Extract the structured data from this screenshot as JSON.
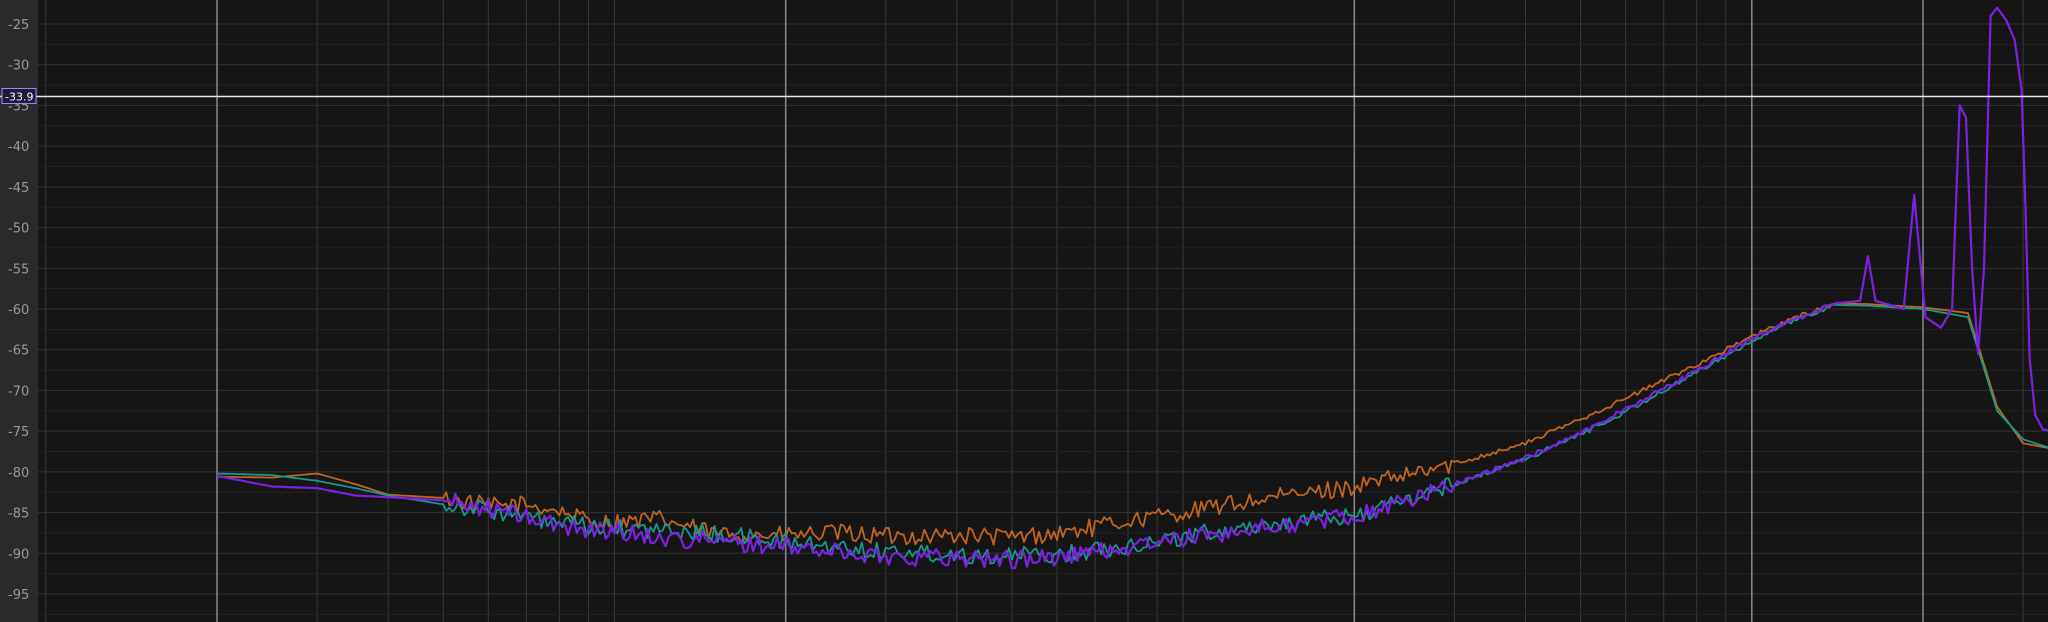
{
  "chart_data": {
    "type": "line",
    "title": "",
    "xlabel": "",
    "ylabel": "",
    "x_scale": "log",
    "xlim": [
      10,
      30000
    ],
    "ylim": [
      -97.5,
      -21.5
    ],
    "grid": true,
    "legend": "none",
    "y_ticks": [
      -25,
      -30,
      -35,
      -40,
      -45,
      -50,
      -55,
      -60,
      -65,
      -70,
      -75,
      -80,
      -85,
      -90,
      -95
    ],
    "y_tick_labels": [
      "-25",
      "-30",
      "-35",
      "-40",
      "-45",
      "-50",
      "-55",
      "-60",
      "-65",
      "-70",
      "-75",
      "-80",
      "-85",
      "-90",
      "-95"
    ],
    "major_x_lines": [
      20,
      200,
      2000,
      10000,
      20000
    ],
    "cursor": {
      "level": -33.9,
      "label": "-33.9"
    },
    "series": [
      {
        "color": "#c0651e",
        "points": [
          [
            20,
            -80.6
          ],
          [
            25,
            -80.7
          ],
          [
            30,
            -80.2
          ],
          [
            35,
            -81.5
          ],
          [
            40,
            -82.8
          ],
          [
            50,
            -83.2
          ],
          [
            60,
            -84.2
          ],
          [
            70,
            -84.0
          ],
          [
            80,
            -84.8
          ],
          [
            90,
            -86.0
          ],
          [
            100,
            -86.2
          ],
          [
            120,
            -85.8
          ],
          [
            150,
            -87.6
          ],
          [
            200,
            -87.8
          ],
          [
            250,
            -87.5
          ],
          [
            300,
            -87.9
          ],
          [
            400,
            -87.8
          ],
          [
            500,
            -88.0
          ],
          [
            600,
            -87.6
          ],
          [
            700,
            -86.8
          ],
          [
            800,
            -86.0
          ],
          [
            1000,
            -85.0
          ],
          [
            1200,
            -84.0
          ],
          [
            1500,
            -83.0
          ],
          [
            2000,
            -81.8
          ],
          [
            2500,
            -80.4
          ],
          [
            3000,
            -79.0
          ],
          [
            4000,
            -76.5
          ],
          [
            5000,
            -73.5
          ],
          [
            6000,
            -71.0
          ],
          [
            8000,
            -66.8
          ],
          [
            10000,
            -63.4
          ],
          [
            12000,
            -61.0
          ],
          [
            14000,
            -59.3
          ],
          [
            16000,
            -59.4
          ],
          [
            20000,
            -59.8
          ],
          [
            24000,
            -60.5
          ],
          [
            27000,
            -72.0
          ],
          [
            30000,
            -76.5
          ],
          [
            36000,
            -77.5
          ]
        ]
      },
      {
        "color": "#17988a",
        "points": [
          [
            20,
            -80.2
          ],
          [
            25,
            -80.4
          ],
          [
            30,
            -81.1
          ],
          [
            35,
            -82.0
          ],
          [
            40,
            -82.9
          ],
          [
            50,
            -84.0
          ],
          [
            60,
            -84.6
          ],
          [
            70,
            -85.6
          ],
          [
            80,
            -86.4
          ],
          [
            90,
            -86.7
          ],
          [
            100,
            -87.0
          ],
          [
            120,
            -87.2
          ],
          [
            150,
            -87.6
          ],
          [
            200,
            -88.6
          ],
          [
            250,
            -89.3
          ],
          [
            300,
            -89.7
          ],
          [
            400,
            -90.1
          ],
          [
            500,
            -90.3
          ],
          [
            600,
            -90.2
          ],
          [
            700,
            -89.6
          ],
          [
            800,
            -89.0
          ],
          [
            1000,
            -88.0
          ],
          [
            1200,
            -87.0
          ],
          [
            1500,
            -86.3
          ],
          [
            2000,
            -85.4
          ],
          [
            2500,
            -83.4
          ],
          [
            3000,
            -81.5
          ],
          [
            4000,
            -78.4
          ],
          [
            5000,
            -75.4
          ],
          [
            6000,
            -72.6
          ],
          [
            8000,
            -67.8
          ],
          [
            10000,
            -63.9
          ],
          [
            12000,
            -61.3
          ],
          [
            14000,
            -59.5
          ],
          [
            16000,
            -59.6
          ],
          [
            20000,
            -60.0
          ],
          [
            24000,
            -61.0
          ],
          [
            27000,
            -72.5
          ],
          [
            30000,
            -76.0
          ],
          [
            36000,
            -77.8
          ]
        ]
      },
      {
        "color": "#7b22e0",
        "points": [
          [
            20,
            -80.5
          ],
          [
            25,
            -81.8
          ],
          [
            30,
            -82.0
          ],
          [
            35,
            -82.9
          ],
          [
            40,
            -83.1
          ],
          [
            50,
            -83.5
          ],
          [
            60,
            -84.5
          ],
          [
            70,
            -85.5
          ],
          [
            80,
            -86.7
          ],
          [
            90,
            -87.0
          ],
          [
            100,
            -87.2
          ],
          [
            120,
            -88.1
          ],
          [
            150,
            -88.5
          ],
          [
            200,
            -89.2
          ],
          [
            250,
            -89.9
          ],
          [
            300,
            -90.4
          ],
          [
            400,
            -90.5
          ],
          [
            500,
            -90.8
          ],
          [
            600,
            -90.5
          ],
          [
            700,
            -89.8
          ],
          [
            800,
            -89.3
          ],
          [
            1000,
            -88.2
          ],
          [
            1200,
            -87.4
          ],
          [
            1500,
            -86.6
          ],
          [
            2000,
            -85.4
          ],
          [
            2500,
            -83.4
          ],
          [
            3000,
            -81.5
          ],
          [
            4000,
            -78.3
          ],
          [
            5000,
            -75.2
          ],
          [
            6000,
            -72.3
          ],
          [
            8000,
            -67.6
          ],
          [
            10000,
            -63.6
          ],
          [
            12000,
            -61.2
          ],
          [
            14000,
            -59.3
          ],
          [
            15500,
            -59.0
          ],
          [
            16000,
            -53.5
          ],
          [
            16500,
            -59.0
          ],
          [
            17500,
            -59.5
          ],
          [
            18500,
            -60.0
          ],
          [
            19300,
            -46.0
          ],
          [
            20200,
            -61.0
          ],
          [
            21000,
            -61.8
          ],
          [
            21500,
            -62.3
          ],
          [
            22500,
            -60.0
          ],
          [
            23200,
            -35.0
          ],
          [
            23800,
            -36.5
          ],
          [
            24400,
            -55.0
          ],
          [
            25000,
            -65.5
          ],
          [
            25600,
            -55.0
          ],
          [
            26300,
            -24.0
          ],
          [
            27000,
            -23.0
          ],
          [
            28000,
            -24.5
          ],
          [
            29000,
            -27.0
          ],
          [
            29800,
            -33.0
          ],
          [
            30300,
            -48.0
          ],
          [
            30800,
            -66.0
          ],
          [
            31500,
            -73.0
          ],
          [
            32500,
            -74.8
          ],
          [
            34000,
            -75.0
          ],
          [
            36000,
            -76.7
          ],
          [
            38000,
            -78.0
          ]
        ]
      }
    ]
  }
}
